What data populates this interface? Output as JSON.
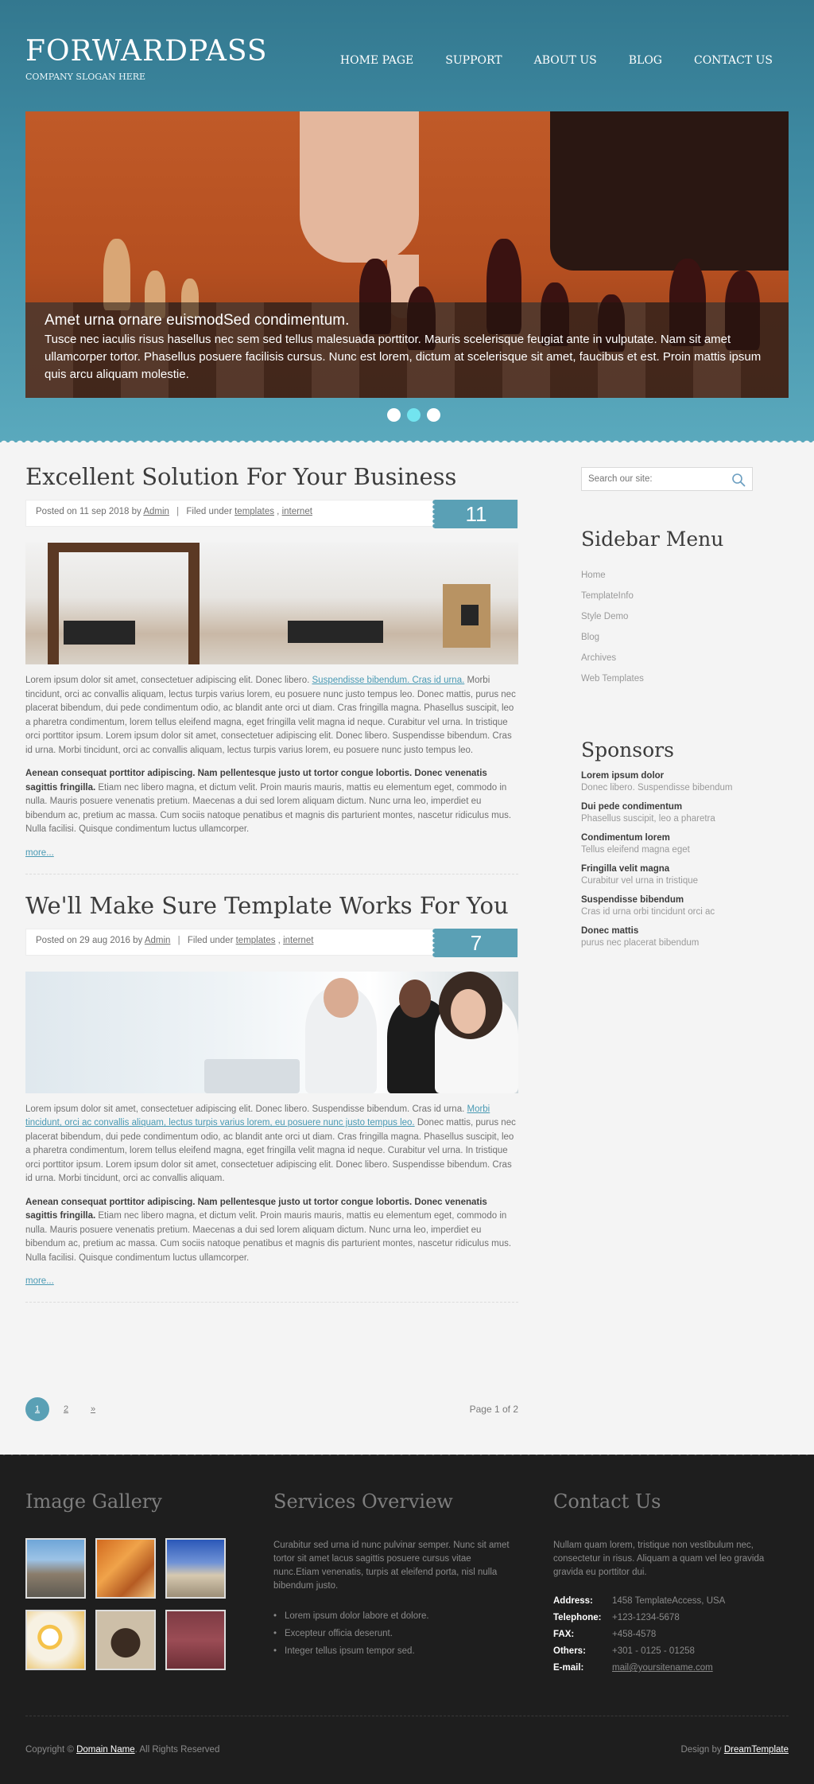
{
  "header": {
    "logo": "FORWARDPASS",
    "slogan": "COMPANY SLOGAN HERE",
    "nav": [
      "HOME PAGE",
      "SUPPORT",
      "ABOUT US",
      "BLOG",
      "CONTACT US"
    ]
  },
  "slider": {
    "caption_title": "Amet urna ornare euismodSed condimentum.",
    "caption_text": "Tusce nec iaculis risus hasellus nec sem sed tellus malesuada porttitor. Mauris scelerisque feugiat ante in vulputate. Nam sit amet ullamcorper tortor. Phasellus posuere facilisis cursus. Nunc est lorem, dictum at scelerisque sit amet, faucibus et est. Proin mattis ipsum quis arcu aliquam molestie.",
    "dots": 3,
    "active_dot": 2
  },
  "posts": [
    {
      "title": "Excellent Solution For Your Business",
      "posted_prefix": "Posted on 11 sep 2018 by",
      "author": "Admin",
      "filed_prefix": "Filed under",
      "tag1": "templates",
      "tag2": "internet",
      "day": "11",
      "p1_start": "Lorem ipsum dolor sit amet, consectetuer adipiscing elit. Donec libero.",
      "p1_link": "Suspendisse bibendum. Cras id urna.",
      "p1_end": "Morbi tincidunt, orci ac convallis aliquam, lectus turpis varius lorem, eu posuere nunc justo tempus leo. Donec mattis, purus nec placerat bibendum, dui pede condimentum odio, ac blandit ante orci ut diam. Cras fringilla magna. Phasellus suscipit, leo a pharetra condimentum, lorem tellus eleifend magna, eget fringilla velit magna id neque. Curabitur vel urna. In tristique orci porttitor ipsum. Lorem ipsum dolor sit amet, consectetuer adipiscing elit. Donec libero. Suspendisse bibendum. Cras id urna. Morbi tincidunt, orci ac convallis aliquam, lectus turpis varius lorem, eu posuere nunc justo tempus leo.",
      "p2_bold": "Aenean consequat porttitor adipiscing. Nam pellentesque justo ut tortor congue lobortis. Donec venenatis sagittis fringilla.",
      "p2_text": "Etiam nec libero magna, et dictum velit. Proin mauris mauris, mattis eu elementum eget, commodo in nulla. Mauris posuere venenatis pretium. Maecenas a dui sed lorem aliquam dictum. Nunc urna leo, imperdiet eu bibendum ac, pretium ac massa. Cum sociis natoque penatibus et magnis dis parturient montes, nascetur ridiculus mus. Nulla facilisi. Quisque condimentum luctus ullamcorper.",
      "more": "more..."
    },
    {
      "title": "We'll Make Sure Template Works For You",
      "posted_prefix": "Posted on 29 aug 2016 by",
      "author": "Admin",
      "filed_prefix": "Filed under",
      "tag1": "templates",
      "tag2": "internet",
      "day": "7",
      "p1_start": "Lorem ipsum dolor sit amet, consectetuer adipiscing elit. Donec libero. Suspendisse bibendum. Cras id urna.",
      "p1_link": "Morbi tincidunt, orci ac convallis aliquam, lectus turpis varius lorem, eu posuere nunc justo tempus leo.",
      "p1_end": "Donec mattis, purus nec placerat bibendum, dui pede condimentum odio, ac blandit ante orci ut diam. Cras fringilla magna. Phasellus suscipit, leo a pharetra condimentum, lorem tellus eleifend magna, eget fringilla velit magna id neque. Curabitur vel urna. In tristique orci porttitor ipsum. Lorem ipsum dolor sit amet, consectetuer adipiscing elit. Donec libero. Suspendisse bibendum. Cras id urna. Morbi tincidunt, orci ac convallis aliquam.",
      "p2_bold": "Aenean consequat porttitor adipiscing. Nam pellentesque justo ut tortor congue lobortis. Donec venenatis sagittis fringilla.",
      "p2_text": "Etiam nec libero magna, et dictum velit. Proin mauris mauris, mattis eu elementum eget, commodo in nulla. Mauris posuere venenatis pretium. Maecenas a dui sed lorem aliquam dictum. Nunc urna leo, imperdiet eu bibendum ac, pretium ac massa. Cum sociis natoque penatibus et magnis dis parturient montes, nascetur ridiculus mus. Nulla facilisi. Quisque condimentum luctus ullamcorper.",
      "more": "more..."
    }
  ],
  "pagination": {
    "pages": [
      "1",
      "2",
      "»"
    ],
    "current": "1",
    "info": "Page 1 of 2"
  },
  "sidebar": {
    "search_placeholder": "Search our site:",
    "menu_title": "Sidebar Menu",
    "menu": [
      "Home",
      "TemplateInfo",
      "Style Demo",
      "Blog",
      "Archives",
      "Web Templates"
    ],
    "sponsors_title": "Sponsors",
    "sponsors": [
      {
        "title": "Lorem ipsum dolor",
        "subtitle": "Donec libero. Suspendisse bibendum"
      },
      {
        "title": "Dui pede condimentum",
        "subtitle": "Phasellus suscipit, leo a pharetra"
      },
      {
        "title": "Condimentum lorem",
        "subtitle": "Tellus eleifend magna eget"
      },
      {
        "title": "Fringilla velit magna",
        "subtitle": "Curabitur vel urna in tristique"
      },
      {
        "title": "Suspendisse bibendum",
        "subtitle": "Cras id urna orbi tincidunt orci ac"
      },
      {
        "title": "Donec mattis",
        "subtitle": "purus nec placerat bibendum"
      }
    ]
  },
  "footer": {
    "gallery_title": "Image Gallery",
    "services_title": "Services Overview",
    "services_text": "Curabitur sed urna id nunc pulvinar semper. Nunc sit amet tortor sit amet lacus sagittis posuere cursus vitae nunc.Etiam venenatis, turpis at eleifend porta, nisl nulla bibendum justo.",
    "services_list": [
      "Lorem ipsum dolor labore et dolore.",
      "Excepteur officia deserunt.",
      "Integer tellus ipsum tempor sed."
    ],
    "contact_title": "Contact Us",
    "contact_text": "Nullam quam lorem, tristique non vestibulum nec, consectetur in risus. Aliquam a quam vel leo gravida gravida eu porttitor dui.",
    "contact": [
      {
        "label": "Address:",
        "value": "1458 TemplateAccess, USA"
      },
      {
        "label": "Telephone:",
        "value": "+123-1234-5678"
      },
      {
        "label": "FAX:",
        "value": "+458-4578"
      },
      {
        "label": "Others:",
        "value": "+301 - 0125 - 01258"
      },
      {
        "label": "E-mail:",
        "value": "mail@yoursitename.com"
      }
    ],
    "copyright_prefix": "Copyright ©",
    "domain": "Domain Name",
    "rights": ". All Rights Reserved",
    "design_prefix": "Design by",
    "design_link": "DreamTemplate"
  },
  "colors": {
    "accent": "#5aa0b5",
    "header_dark": "#33788f",
    "footer_bg": "#1e1e1e",
    "link": "#4a9ab4"
  }
}
